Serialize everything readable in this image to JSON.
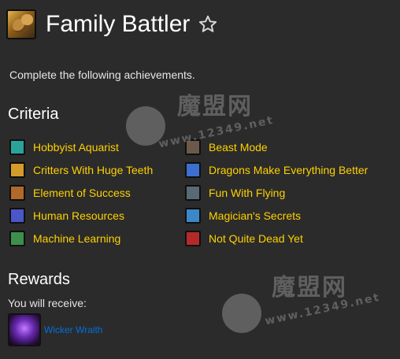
{
  "achievement": {
    "title": "Family Battler",
    "description": "Complete the following achievements.",
    "icon": "achievement-icon",
    "favorite_icon": "star-outline-icon"
  },
  "criteria": {
    "title": "Criteria",
    "left": [
      {
        "label": "Hobbyist Aquarist",
        "icon_color": "#2aa39b"
      },
      {
        "label": "Critters With Huge Teeth",
        "icon_color": "#d49a2a"
      },
      {
        "label": "Element of Success",
        "icon_color": "#b0692a"
      },
      {
        "label": "Human Resources",
        "icon_color": "#4b57c8"
      },
      {
        "label": "Machine Learning",
        "icon_color": "#3e8f4c"
      }
    ],
    "right": [
      {
        "label": "Beast Mode",
        "icon_color": "#6b5a4a"
      },
      {
        "label": "Dragons Make Everything Better",
        "icon_color": "#3d6fd0"
      },
      {
        "label": "Fun With Flying",
        "icon_color": "#5a6a74"
      },
      {
        "label": "Magician's Secrets",
        "icon_color": "#3a88c7"
      },
      {
        "label": "Not Quite Dead Yet",
        "icon_color": "#b42a2a"
      }
    ]
  },
  "rewards": {
    "title": "Rewards",
    "receive_label": "You will receive:",
    "item_name": "Wicker Wraith",
    "item_color": "#0070dd"
  },
  "watermarks": [
    {
      "text": "魔盟网",
      "url": "www.12349.net"
    },
    {
      "text": "魔盟网",
      "url": "www.12349.net"
    }
  ],
  "colors": {
    "background": "#2b2b2b",
    "criteria_link": "#ffd100",
    "heading": "#ffffff"
  }
}
